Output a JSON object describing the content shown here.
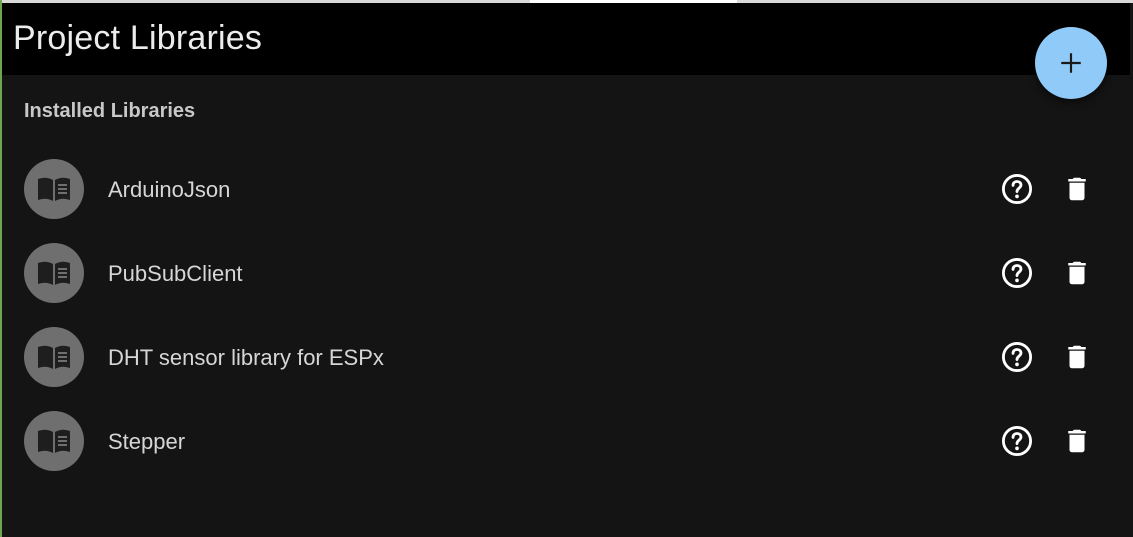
{
  "header": {
    "title": "Project Libraries",
    "add_icon": "plus-icon"
  },
  "section": {
    "title": "Installed Libraries"
  },
  "libraries": [
    {
      "name": "ArduinoJson"
    },
    {
      "name": "PubSubClient"
    },
    {
      "name": "DHT sensor library for ESPx"
    },
    {
      "name": "Stepper"
    }
  ],
  "icons": {
    "library": "book-icon",
    "help": "help-circle-icon",
    "delete": "trash-icon"
  },
  "colors": {
    "app_bar": "#000000",
    "background": "#141414",
    "fab": "#90caf9",
    "avatar": "#6f6f6f",
    "text": "#d6d6d6"
  }
}
